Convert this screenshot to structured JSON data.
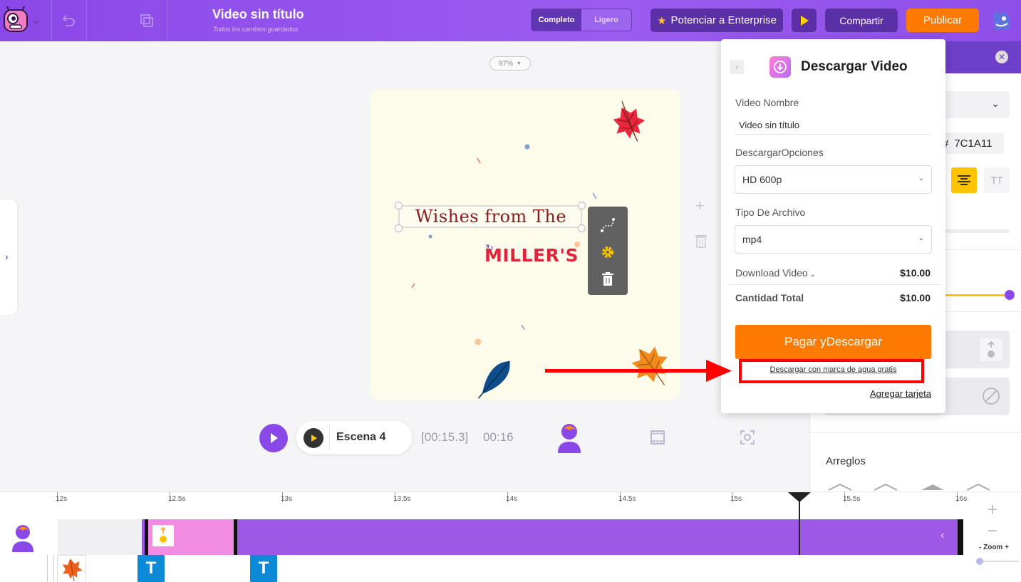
{
  "header": {
    "title": "Video sin título",
    "subtitle": "Todos los cambios guardados",
    "mode_full": "Completo",
    "mode_light": "Ligero",
    "enterprise_label": "Potenciar a Enterprise",
    "share_label": "Compartir",
    "publish_label": "Publicar"
  },
  "canvas": {
    "zoom": "97%",
    "text_line1": "Wishes from The",
    "text_line2": "MILLER'S"
  },
  "playback": {
    "scene_label": "Escena 4",
    "current_time": "[00:15.3]",
    "total_time": "00:16"
  },
  "right_panel": {
    "color_hex": "7C1A11",
    "hash": "#",
    "arrange_label": "Arreglos",
    "text_case_icon": "TT"
  },
  "download_modal": {
    "title": "Descargar Video",
    "name_label": "Video Nombre",
    "name_value": "Video sin título",
    "options_label": "DescargarOpciones",
    "options_value": "HD 600p",
    "filetype_label": "Tipo De Archivo",
    "filetype_value": "mp4",
    "download_row_label": "Download Video",
    "download_row_amount": "$10.00",
    "total_label": "Cantidad Total",
    "total_amount": "$10.00",
    "pay_button": "Pagar yDescargar",
    "free_link": "Descargar con marca de agua gratis",
    "add_card": "Agregar tarjeta"
  },
  "timeline": {
    "ticks": [
      "12s",
      "12.5s",
      "13s",
      "13.5s",
      "14s",
      "14.5s",
      "15s",
      "15.5s",
      "16s"
    ],
    "zoom_label": "- Zoom +",
    "text_block_label": "T"
  },
  "colors": {
    "brand_purple": "#8b48e8",
    "accent_orange": "#ff7a00",
    "annotation_red": "#ff0000",
    "highlight_yellow": "#ffc400"
  },
  "icons": [
    "app-logo-icon",
    "undo-icon",
    "duplicate-icon",
    "play-icon",
    "star-icon",
    "user-avatar-icon",
    "gear-icon",
    "trash-icon",
    "animation-path-icon",
    "download-icon",
    "chevron-down-icon",
    "film-icon",
    "fullscreen-icon",
    "character-icon",
    "close-icon",
    "align-center-icon",
    "zoom-plus-icon",
    "zoom-minus-icon"
  ]
}
